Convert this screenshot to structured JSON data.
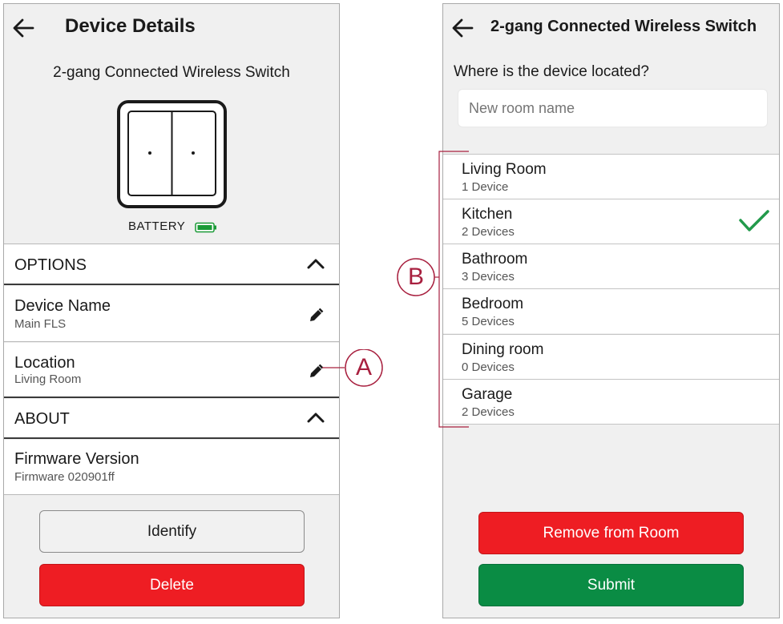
{
  "left": {
    "title": "Device Details",
    "device_name_heading": "2-gang Connected Wireless Switch",
    "battery_label": "BATTERY",
    "options_header": "OPTIONS",
    "device_name_label": "Device Name",
    "device_name_value": "Main FLS",
    "location_label": "Location",
    "location_value": "Living Room",
    "about_header": "ABOUT",
    "firmware_label": "Firmware Version",
    "firmware_value": "Firmware 020901ff",
    "identify_button": "Identify",
    "delete_button": "Delete"
  },
  "right": {
    "title": "2-gang Connected Wireless Switch",
    "question": "Where is the device located?",
    "room_input_placeholder": "New room name",
    "rooms": [
      {
        "name": "Living Room",
        "count": "1 Device"
      },
      {
        "name": "Kitchen",
        "count": "2 Devices"
      },
      {
        "name": "Bathroom",
        "count": "3 Devices"
      },
      {
        "name": "Bedroom",
        "count": "5 Devices"
      },
      {
        "name": "Dining room",
        "count": "0 Devices"
      },
      {
        "name": "Garage",
        "count": "2 Devices"
      }
    ],
    "selected_room": "Kitchen",
    "remove_button": "Remove from Room",
    "submit_button": "Submit"
  },
  "callouts": {
    "a": "A",
    "b": "B"
  },
  "colors": {
    "delete": "#ee1d23",
    "submit": "#0a8c44",
    "callout": "#a8203f",
    "check": "#229a4b",
    "battery": "#1a9a36"
  },
  "icons": [
    "back-arrow-icon",
    "switch-device-icon",
    "battery-icon",
    "chevron-up-icon",
    "pencil-icon",
    "checkmark-icon"
  ]
}
